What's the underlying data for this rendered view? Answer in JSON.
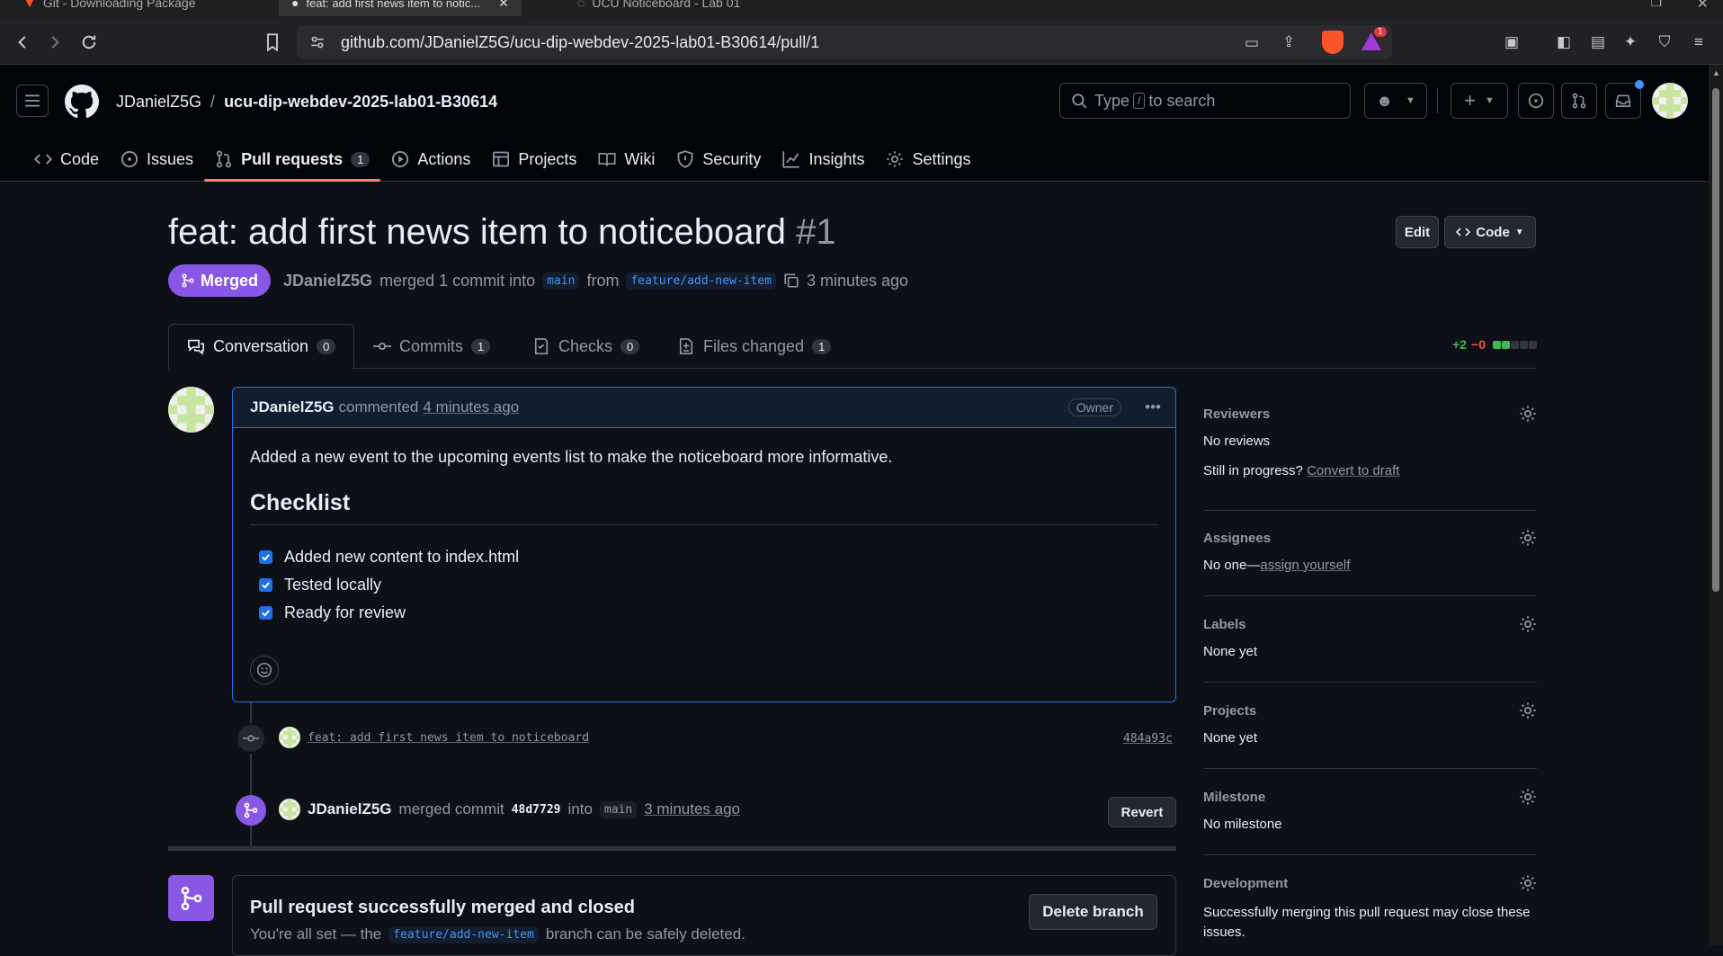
{
  "browser": {
    "tabs": [
      {
        "label": "Git - Downloading Package"
      },
      {
        "label": "feat: add first news item to notic..."
      },
      {
        "label": "UCU Noticeboard - Lab 01"
      }
    ],
    "url": "github.com/JDanielZ5G/ucu-dip-webdev-2025-lab01-B30614/pull/1",
    "notification_count": "1"
  },
  "header": {
    "owner": "JDanielZ5G",
    "separator": "/",
    "repo": "ucu-dip-webdev-2025-lab01-B30614",
    "search_prefix": "Type",
    "search_key": "/",
    "search_suffix": "to search"
  },
  "repo_nav": [
    {
      "label": "Code",
      "icon": "code-icon"
    },
    {
      "label": "Issues",
      "icon": "issue-icon"
    },
    {
      "label": "Pull requests",
      "icon": "pull-request-icon",
      "count": "1",
      "selected": true
    },
    {
      "label": "Actions",
      "icon": "play-icon"
    },
    {
      "label": "Projects",
      "icon": "table-icon"
    },
    {
      "label": "Wiki",
      "icon": "book-icon"
    },
    {
      "label": "Security",
      "icon": "shield-icon"
    },
    {
      "label": "Insights",
      "icon": "graph-icon"
    },
    {
      "label": "Settings",
      "icon": "gear-icon"
    }
  ],
  "pr": {
    "title": "feat: add first news item to noticeboard",
    "number": "#1",
    "edit_label": "Edit",
    "code_label": "Code",
    "state": "Merged",
    "author": "JDanielZ5G",
    "merged_text": "merged 1 commit into",
    "base_branch": "main",
    "from_text": "from",
    "head_branch": "feature/add-new-item",
    "time": "3 minutes ago"
  },
  "pr_tabs": [
    {
      "label": "Conversation",
      "count": "0"
    },
    {
      "label": "Commits",
      "count": "1"
    },
    {
      "label": "Checks",
      "count": "0"
    },
    {
      "label": "Files changed",
      "count": "1"
    }
  ],
  "diffstat": {
    "additions": "+2",
    "deletions": "−0"
  },
  "comment": {
    "author": "JDanielZ5G",
    "action": "commented",
    "time": "4 minutes ago",
    "role": "Owner",
    "body": "Added a new event to the upcoming events list to make the noticeboard more informative.",
    "heading": "Checklist",
    "checklist": [
      {
        "label": "Added new content to index.html",
        "checked": true
      },
      {
        "label": "Tested locally",
        "checked": true
      },
      {
        "label": "Ready for review",
        "checked": true
      }
    ]
  },
  "commit_event": {
    "message": "feat: add first news item to noticeboard",
    "sha": "484a93c"
  },
  "merge_event": {
    "author": "JDanielZ5G",
    "text1": "merged commit",
    "sha": "48d7729",
    "text2": "into",
    "branch": "main",
    "time": "3 minutes ago",
    "revert_label": "Revert"
  },
  "merged_box": {
    "title": "Pull request successfully merged and closed",
    "text1": "You're all set — the",
    "branch": "feature/add-new-item",
    "text2": "branch can be safely deleted.",
    "delete_label": "Delete branch"
  },
  "sidebar": {
    "reviewers": {
      "heading": "Reviewers",
      "value": "No reviews",
      "note": "Still in progress?",
      "link": "Convert to draft"
    },
    "assignees": {
      "heading": "Assignees",
      "value": "No one—",
      "link": "assign yourself"
    },
    "labels": {
      "heading": "Labels",
      "value": "None yet"
    },
    "projects": {
      "heading": "Projects",
      "value": "None yet"
    },
    "milestone": {
      "heading": "Milestone",
      "value": "No milestone"
    },
    "development": {
      "heading": "Development",
      "value": "Successfully merging this pull request may close these issues."
    }
  },
  "colors": {
    "background": "#0d1117",
    "header": "#010409",
    "merged": "#8957e5",
    "accent": "#1f6feb",
    "link": "#4493f8",
    "additions": "#3fb950",
    "deletions": "#f85149"
  }
}
